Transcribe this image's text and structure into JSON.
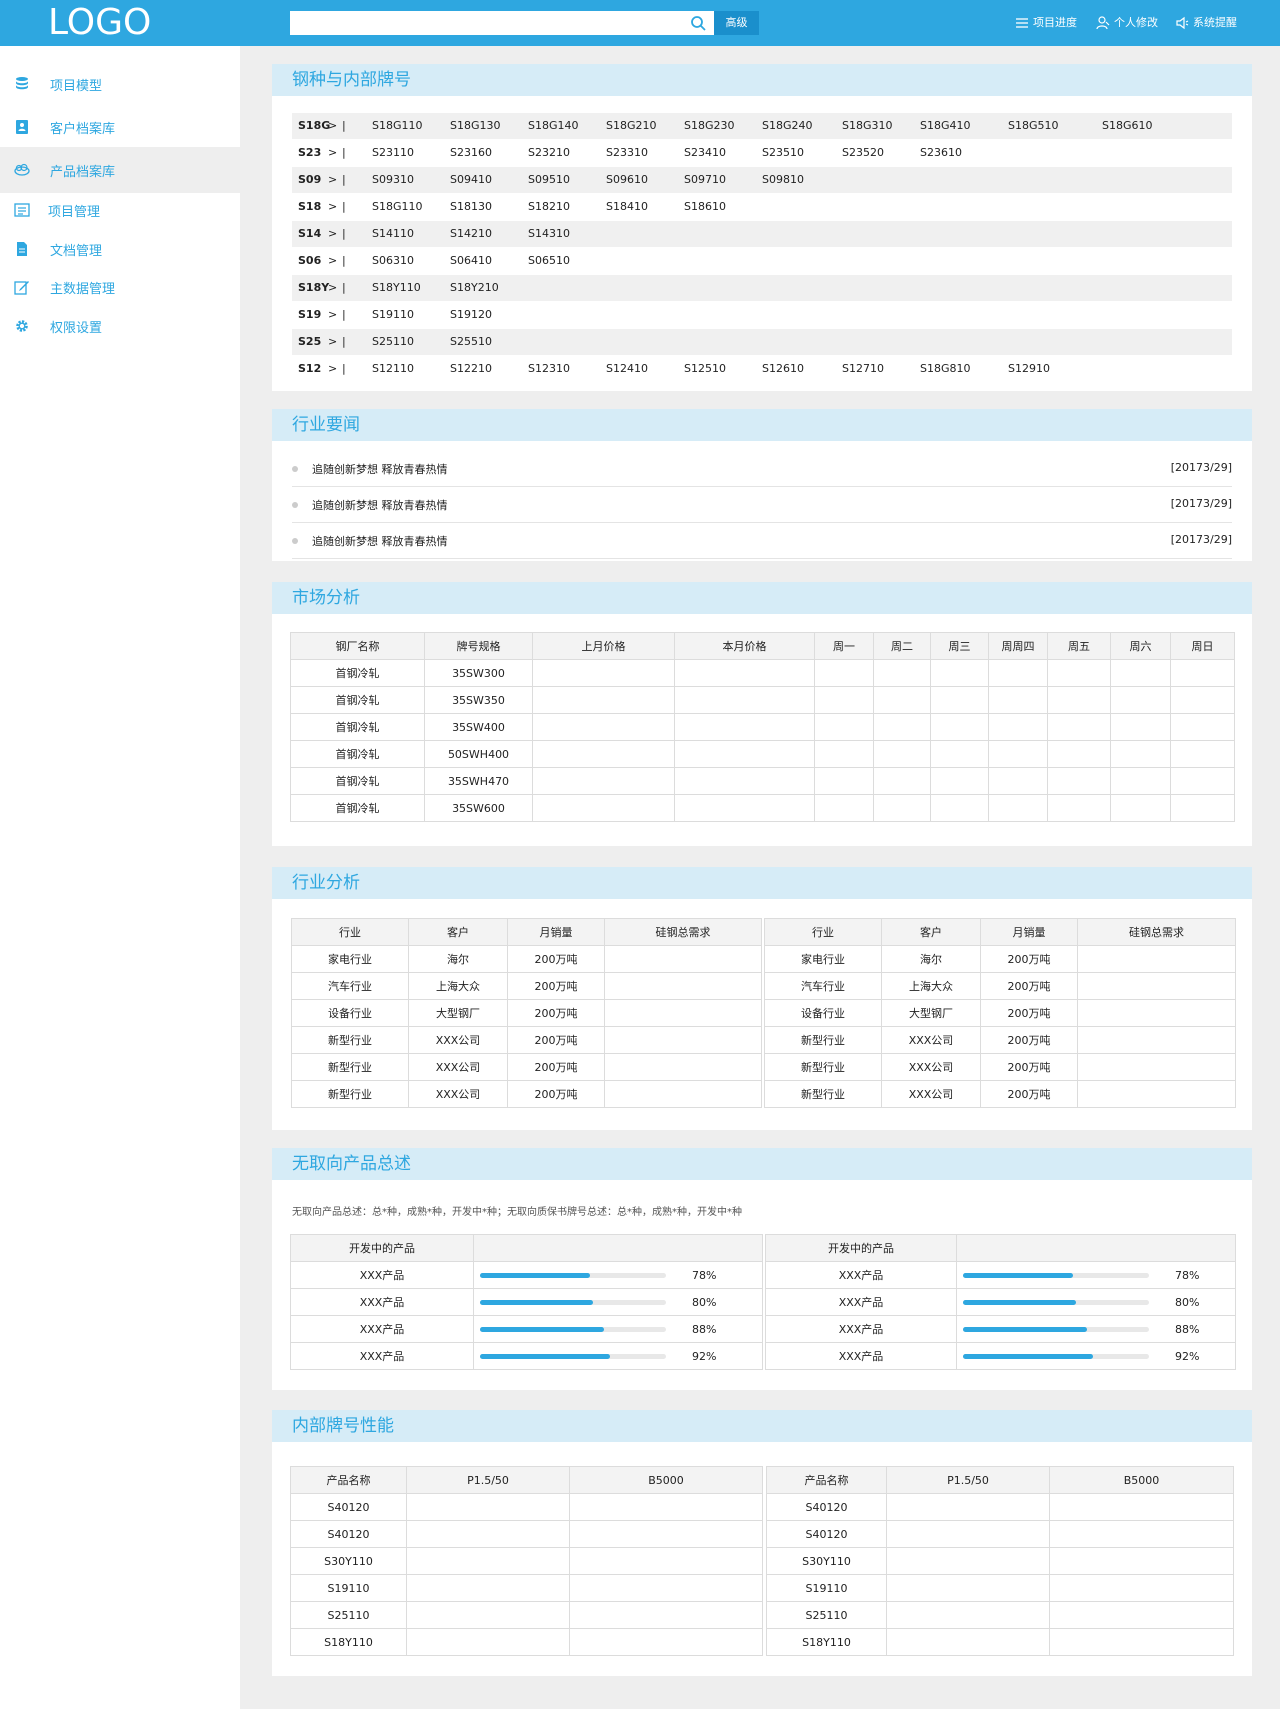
{
  "header": {
    "logo": "LOGO",
    "search_placeholder": "",
    "adv": "高级",
    "nav": [
      "项目进度",
      "个人修改",
      "系统提醒"
    ]
  },
  "sidebar": {
    "items": [
      "项目模型",
      "客户档案库",
      "产品档案库",
      "项目管理",
      "文档管理",
      "主数据管理",
      "权限设置"
    ]
  },
  "steel": {
    "title": "钢种与内部牌号",
    "rows": [
      {
        "key": "S18G",
        "vals": [
          "S18G110",
          "S18G130",
          "S18G140",
          "S18G210",
          "S18G230",
          "S18G240",
          "S18G310",
          "S18G410",
          "S18G510",
          "S18G610"
        ]
      },
      {
        "key": "S23",
        "vals": [
          "S23110",
          "S23160",
          "S23210",
          "S23310",
          "S23410",
          "S23510",
          "S23520",
          "S23610"
        ]
      },
      {
        "key": "S09",
        "vals": [
          "S09310",
          "S09410",
          "S09510",
          "S09610",
          "S09710",
          "S09810"
        ]
      },
      {
        "key": "S18",
        "vals": [
          "S18G110",
          "S18130",
          "S18210",
          "S18410",
          "S18610"
        ]
      },
      {
        "key": "S14",
        "vals": [
          "S14110",
          "S14210",
          "S14310"
        ]
      },
      {
        "key": "S06",
        "vals": [
          "S06310",
          "S06410",
          "S06510"
        ]
      },
      {
        "key": "S18Y",
        "vals": [
          "S18Y110",
          "S18Y210"
        ]
      },
      {
        "key": "S19",
        "vals": [
          "S19110",
          "S19120"
        ]
      },
      {
        "key": "S25",
        "vals": [
          "S25110",
          "S25510"
        ]
      },
      {
        "key": "S12",
        "vals": [
          "S12110",
          "S12210",
          "S12310",
          "S12410",
          "S12510",
          "S12610",
          "S12710",
          "S18G810",
          "S12910"
        ]
      }
    ]
  },
  "news": {
    "title": "行业要闻",
    "items": [
      {
        "text": "追随创新梦想 释放青春热情",
        "date": "[20173/29]"
      },
      {
        "text": "追随创新梦想 释放青春热情",
        "date": "[20173/29]"
      },
      {
        "text": "追随创新梦想 释放青春热情",
        "date": "[20173/29]"
      }
    ]
  },
  "market": {
    "title": "市场分析",
    "headers": [
      "钢厂名称",
      "牌号规格",
      "上月价格",
      "本月价格",
      "周一",
      "周二",
      "周三",
      "周周四",
      "周五",
      "周六",
      "周日"
    ],
    "rows": [
      [
        "首钢冷轧",
        "35SW300"
      ],
      [
        "首钢冷轧",
        "35SW350"
      ],
      [
        "首钢冷轧",
        "35SW400"
      ],
      [
        "首钢冷轧",
        "50SWH400"
      ],
      [
        "首钢冷轧",
        "35SWH470"
      ],
      [
        "首钢冷轧",
        "35SW600"
      ]
    ]
  },
  "industry": {
    "title": "行业分析",
    "headers": [
      "行业",
      "客户",
      "月销量",
      "硅钢总需求"
    ],
    "rows": [
      [
        "家电行业",
        "海尔",
        "200万吨",
        ""
      ],
      [
        "汽车行业",
        "上海大众",
        "200万吨",
        ""
      ],
      [
        "设备行业",
        "大型钢厂",
        "200万吨",
        ""
      ],
      [
        "新型行业",
        "XXX公司",
        "200万吨",
        ""
      ],
      [
        "新型行业",
        "XXX公司",
        "200万吨",
        ""
      ],
      [
        "新型行业",
        "XXX公司",
        "200万吨",
        ""
      ]
    ]
  },
  "products": {
    "title": "无取向产品总述",
    "summary": "无取向产品总述：总*种，成熟*种，开发中*种；无取向质保书牌号总述：总*种，成熟*种，开发中*种",
    "col_header": "开发中的产品",
    "rows": [
      {
        "name": "XXX产品",
        "pct": "78%",
        "value": 0.78
      },
      {
        "name": "XXX产品",
        "pct": "80%",
        "value": 0.8
      },
      {
        "name": "XXX产品",
        "pct": "88%",
        "value": 0.88
      },
      {
        "name": "XXX产品",
        "pct": "92%",
        "value": 0.92
      }
    ]
  },
  "perf": {
    "title": "内部牌号性能",
    "headers": [
      "产品名称",
      "P1.5/50",
      "B5000"
    ],
    "rows": [
      "S40120",
      "S40120",
      "S30Y110",
      "S19110",
      "S25110",
      "S18Y110"
    ]
  }
}
